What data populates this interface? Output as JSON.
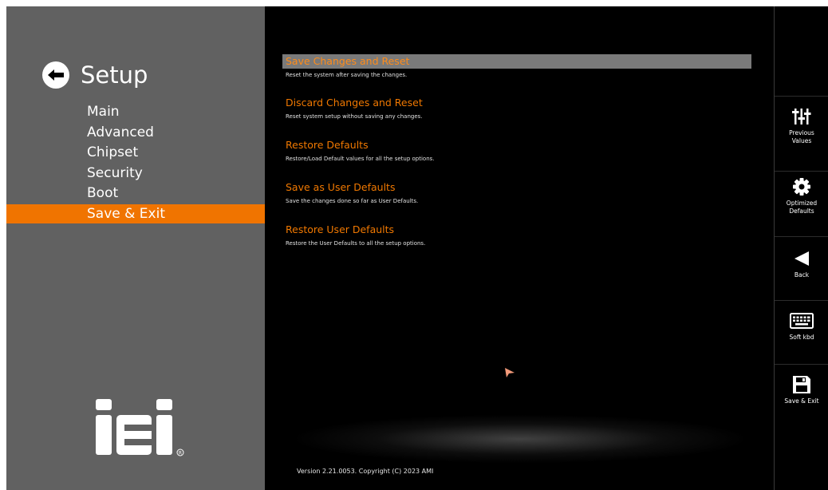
{
  "sidebar": {
    "title": "Setup",
    "items": [
      {
        "label": "Main",
        "active": false
      },
      {
        "label": "Advanced",
        "active": false
      },
      {
        "label": "Chipset",
        "active": false
      },
      {
        "label": "Security",
        "active": false
      },
      {
        "label": "Boot",
        "active": false
      },
      {
        "label": "Save & Exit",
        "active": true
      }
    ],
    "logo_text": "iEi"
  },
  "main": {
    "options": [
      {
        "title": "Save Changes and Reset",
        "desc": "Reset the system after saving the changes.",
        "selected": true
      },
      {
        "title": "Discard Changes and Reset",
        "desc": "Reset system setup without saving any changes.",
        "selected": false
      },
      {
        "title": "Restore Defaults",
        "desc": "Restore/Load Default values for all the setup options.",
        "selected": false
      },
      {
        "title": "Save as User Defaults",
        "desc": "Save the changes done so far as User Defaults.",
        "selected": false
      },
      {
        "title": "Restore User Defaults",
        "desc": "Restore the User Defaults to all the setup options.",
        "selected": false
      }
    ],
    "version": "Version 2.21.0053. Copyright (C) 2023 AMI"
  },
  "toolbar": {
    "previous_values": [
      "Previous",
      "Values"
    ],
    "optimized_defaults": [
      "Optimized",
      "Defaults"
    ],
    "back": "Back",
    "soft_kbd": "Soft kbd",
    "save_exit": "Save & Exit"
  },
  "colors": {
    "accent": "#f07400",
    "sidebar_bg": "#616161",
    "main_bg": "#000000",
    "selected_bg": "#7a7a7a"
  }
}
